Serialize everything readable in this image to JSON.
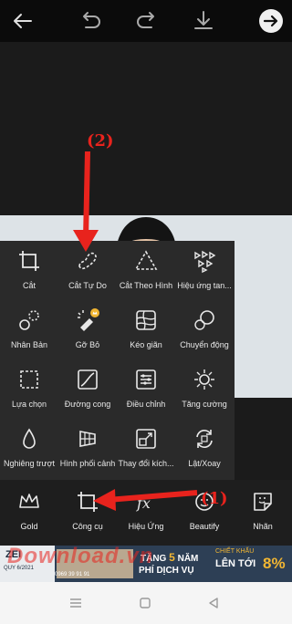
{
  "topbar": {
    "icons": [
      "back-arrow-icon",
      "undo-icon",
      "redo-icon",
      "download-icon",
      "next-icon"
    ]
  },
  "tools": [
    {
      "label": "Cắt",
      "icon": "crop-icon"
    },
    {
      "label": "Cắt Tự Do",
      "icon": "freecrop-icon"
    },
    {
      "label": "Cắt Theo Hình",
      "icon": "shapecrop-icon"
    },
    {
      "label": "Hiệu ứng tan...",
      "icon": "dispersion-icon"
    },
    {
      "label": "Nhân Bản",
      "icon": "clone-icon"
    },
    {
      "label": "Gỡ Bỏ",
      "icon": "remove-icon"
    },
    {
      "label": "Kéo giãn",
      "icon": "stretch-icon"
    },
    {
      "label": "Chuyển động",
      "icon": "motion-icon"
    },
    {
      "label": "Lựa chọn",
      "icon": "selection-icon"
    },
    {
      "label": "Đường cong",
      "icon": "curves-icon"
    },
    {
      "label": "Điều chỉnh",
      "icon": "adjust-icon"
    },
    {
      "label": "Tăng cường",
      "icon": "enhance-icon"
    },
    {
      "label": "Nghiêng trượt",
      "icon": "tiltshift-icon"
    },
    {
      "label": "Hình phối cảnh",
      "icon": "perspective-icon"
    },
    {
      "label": "Thay đổi kích...",
      "icon": "resize-icon"
    },
    {
      "label": "Lật/Xoay",
      "icon": "fliprotate-icon"
    }
  ],
  "bottom_nav": [
    {
      "label": "Gold",
      "icon": "crown-icon"
    },
    {
      "label": "Công cụ",
      "icon": "crop-icon"
    },
    {
      "label": "Hiệu Ứng",
      "icon": "fx-icon"
    },
    {
      "label": "Beautify",
      "icon": "face-icon"
    },
    {
      "label": "Nhãn",
      "icon": "sticker-icon"
    }
  ],
  "annotations": {
    "top": "(2)",
    "bottom": "(1)"
  },
  "ad": {
    "brand": "ZEI",
    "date": "QUY 6/2021",
    "phone": "0969 39 91 91",
    "line1_a": "TẶNG",
    "line1_num": "5",
    "line1_b": "NĂM",
    "line2": "PHÍ DỊCH VỤ",
    "disc_top": "CHIẾT KHẤU",
    "disc_main": "LÊN TỚI",
    "disc_num": "8%",
    "watermark": "Download.vn"
  },
  "colors": {
    "accent": "#e8231d",
    "gold": "#f2b632",
    "panel": "#2a2a2a"
  }
}
